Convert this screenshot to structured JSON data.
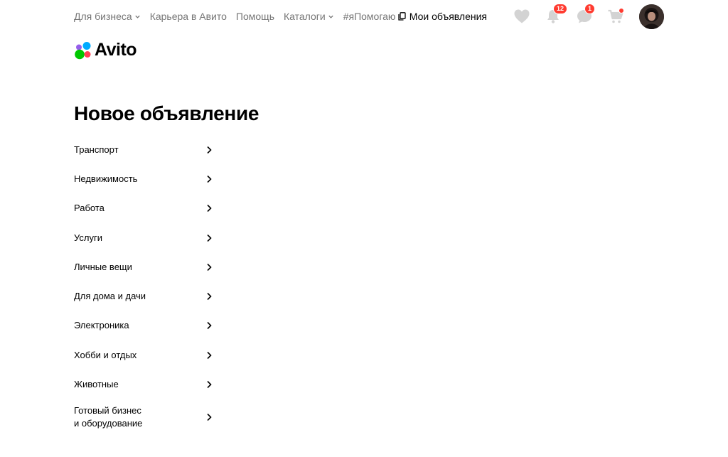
{
  "topnav": {
    "links": [
      {
        "label": "Для бизнеса",
        "has_dropdown": true
      },
      {
        "label": "Карьера в Авито",
        "has_dropdown": false
      },
      {
        "label": "Помощь",
        "has_dropdown": false
      },
      {
        "label": "Каталоги",
        "has_dropdown": true
      },
      {
        "label": "#яПомогаю",
        "has_dropdown": false
      }
    ],
    "my_ads_label": "Мои объявления",
    "icons": {
      "favorites": "heart-icon",
      "notifications": "bell-icon",
      "messages": "chat-icon",
      "cart": "cart-icon"
    },
    "notifications_count": "12",
    "messages_count": "1"
  },
  "logo": {
    "text": "Avito"
  },
  "page": {
    "title": "Новое объявление"
  },
  "categories": [
    {
      "label": "Транспорт"
    },
    {
      "label": "Недвижимость"
    },
    {
      "label": "Работа"
    },
    {
      "label": "Услуги"
    },
    {
      "label": "Личные вещи"
    },
    {
      "label": "Для дома и дачи"
    },
    {
      "label": "Электроника"
    },
    {
      "label": "Хобби и отдых"
    },
    {
      "label": "Животные"
    },
    {
      "label": "Готовый бизнес\nи оборудование"
    }
  ],
  "colors": {
    "nav_text": "#757575",
    "icon_gray": "#d3d3d3",
    "badge": "#ff3b30",
    "logo_green": "#00c800",
    "logo_blue": "#0af",
    "logo_purple": "#965eeb",
    "logo_red": "#ff4053"
  }
}
